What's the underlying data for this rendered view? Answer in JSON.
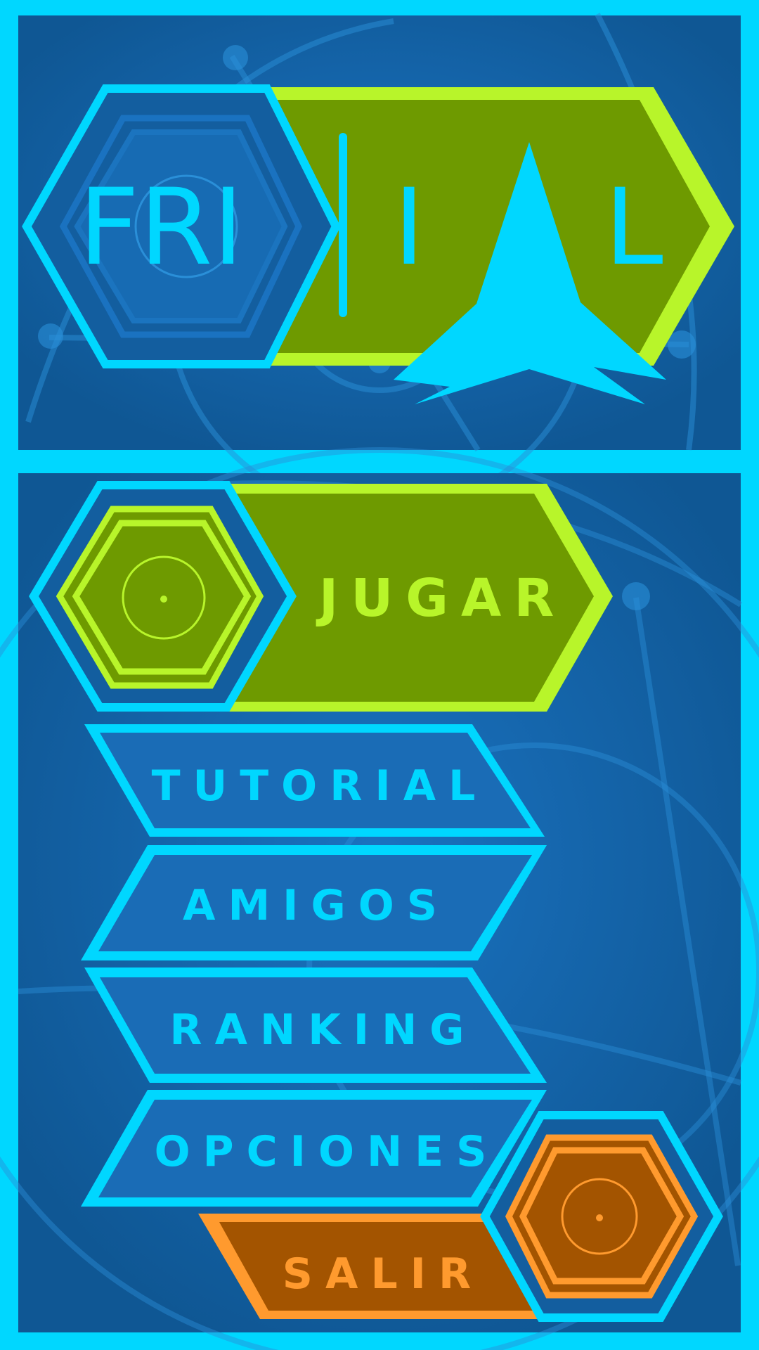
{
  "title": {
    "left": "FRI",
    "right_letters": [
      "I",
      "L"
    ]
  },
  "menu": {
    "play": "JUGAR",
    "tutorial": "TUTORIAL",
    "friends": "AMIGOS",
    "ranking": "RANKING",
    "options": "OPCIONES",
    "exit": "SALIR"
  },
  "colors": {
    "frame": "#00d7ff",
    "background": "#115b96",
    "accent_green": "#6e9a00",
    "accent_lime": "#b8f52a",
    "accent_orange": "#ff9a2e",
    "orange_fill": "#a35400",
    "button_blue": "#1a6cb6"
  },
  "icons": [
    "rocket-icon",
    "hexagon-target-icon"
  ]
}
